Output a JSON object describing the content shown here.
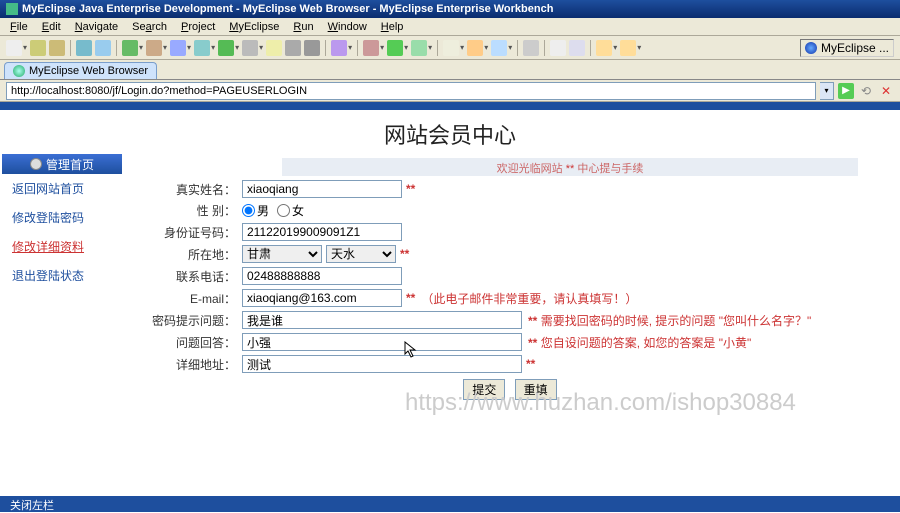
{
  "app": {
    "title": "MyEclipse Java Enterprise Development - MyEclipse Web Browser - MyEclipse Enterprise Workbench"
  },
  "menu": {
    "items": [
      "File",
      "Edit",
      "Navigate",
      "Search",
      "Project",
      "MyEclipse",
      "Run",
      "Window",
      "Help"
    ]
  },
  "toolbar": {
    "eclipse": "MyEclipse ..."
  },
  "tab": {
    "label": "MyEclipse Web Browser"
  },
  "address": {
    "url": "http://localhost:8080/jf/Login.do?method=PAGEUSERLOGIN"
  },
  "page": {
    "title": "网站会员中心",
    "subbar_a": "欢迎光临网站",
    "subbar_b": "中心提与手续"
  },
  "sidebar": {
    "head": "管理首页",
    "items": [
      "返回网站首页",
      "修改登陆密码",
      "修改详细资料",
      "退出登陆状态"
    ],
    "active_index": 2
  },
  "form": {
    "labels": {
      "realname": "真实姓名：",
      "gender": "性  别：",
      "idcard": "身份证号码：",
      "location": "所在地：",
      "phone": "联系电话：",
      "email": "E-mail：",
      "pwdq": "密码提示问题：",
      "pwda": "问题回答：",
      "address": "详细地址："
    },
    "values": {
      "realname": "xiaoqiang",
      "idcard": "211220199009091Z1",
      "phone": "02488888888",
      "email": "xiaoqiang@163.com",
      "pwdq": "我是谁",
      "pwda": "小强",
      "address": "测试"
    },
    "gender": {
      "male": "男",
      "female": "女"
    },
    "province": "甘肃",
    "city": "天水",
    "hints": {
      "email": "（此电子邮件非常重要，请认真填写！）",
      "pwdq": "需要找回密码的时候, 提示的问题 \"您叫什么名字？\"",
      "pwda": "您自设问题的答案, 如您的答案是 \"小黄\""
    },
    "buttons": {
      "submit": "提交",
      "reset": "重填"
    }
  },
  "footer": {
    "text": "关闭左栏"
  },
  "watermark": "https://www.huzhan.com/ishop30884"
}
